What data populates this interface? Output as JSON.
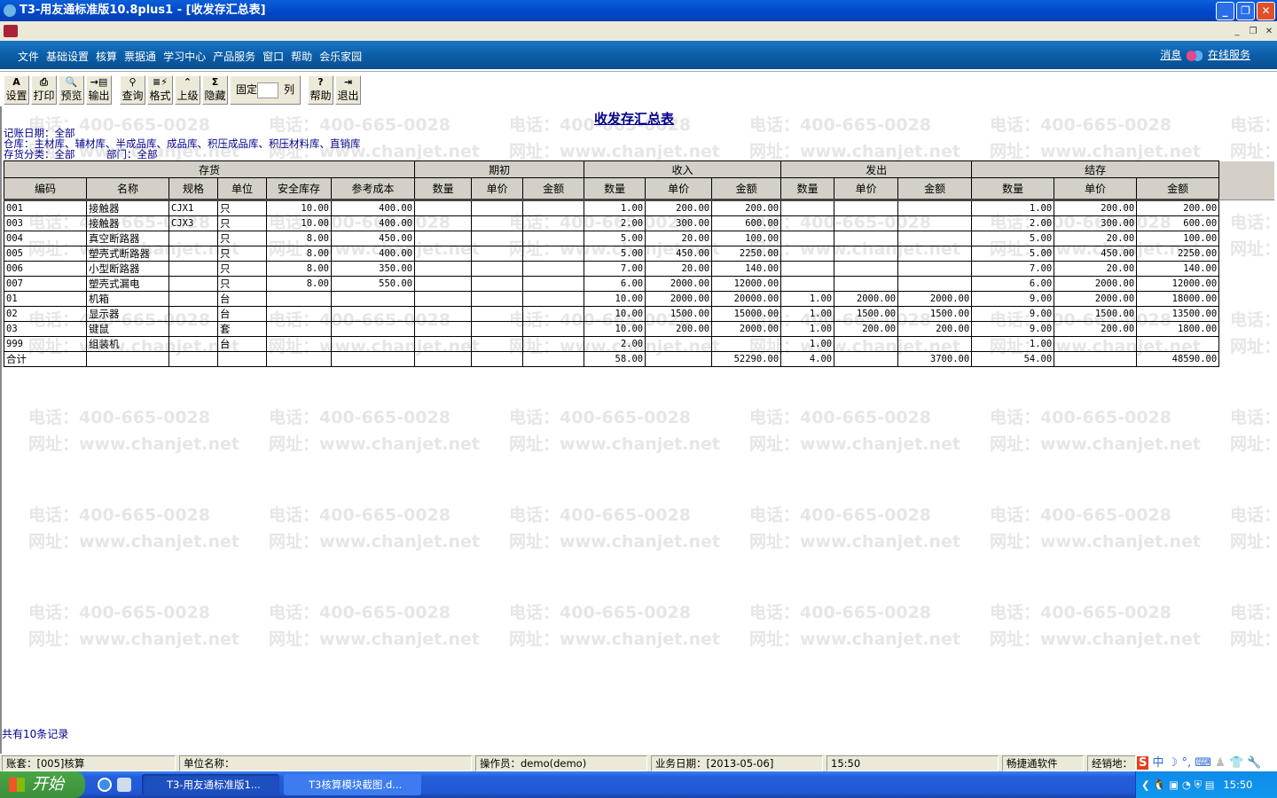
{
  "window": {
    "title": "T3-用友通标准版10.8plus1 - [收发存汇总表]"
  },
  "menu": {
    "items": [
      "文件",
      "基础设置",
      "核算",
      "票据通",
      "学习中心",
      "产品服务",
      "窗口",
      "帮助",
      "会乐家园"
    ],
    "message": "消息",
    "online_service": "在线服务"
  },
  "toolbar": {
    "buttons": [
      {
        "label": "设置",
        "icon": "A"
      },
      {
        "label": "打印",
        "icon": "⎙"
      },
      {
        "label": "预览",
        "icon": "🔍"
      },
      {
        "label": "输出",
        "icon": "→▤"
      },
      {
        "label": "查询",
        "icon": "⚲"
      },
      {
        "label": "格式",
        "icon": "≡⚡"
      },
      {
        "label": "上级",
        "icon": "⌃"
      },
      {
        "label": "隐藏",
        "icon": "Σ"
      },
      {
        "label": "帮助",
        "icon": "?"
      },
      {
        "label": "退出",
        "icon": "⇥"
      }
    ],
    "fix_label": "固定",
    "fix_value": "",
    "col_label": "列"
  },
  "report": {
    "title": "收发存汇总表",
    "conditions": {
      "date": "记账日期：全部",
      "warehouse": "仓库：主材库、辅材库、半成品库、成品库、积压成品库、积压材料库、直销库",
      "category": "存货分类：全部",
      "department": "部门：全部"
    },
    "group_headers": [
      "存货",
      "期初",
      "收入",
      "发出",
      "结存"
    ],
    "columns": [
      "编码",
      "名称",
      "规格",
      "单位",
      "安全库存",
      "参考成本",
      "数量",
      "单价",
      "金额",
      "数量",
      "单价",
      "金额",
      "数量",
      "单价",
      "金额",
      "数量",
      "单价",
      "金额"
    ],
    "rows": [
      [
        "001",
        "接触器",
        "CJX1",
        "只",
        "10.00",
        "400.00",
        "",
        "",
        "",
        "1.00",
        "200.00",
        "200.00",
        "",
        "",
        "",
        "1.00",
        "200.00",
        "200.00"
      ],
      [
        "003",
        "接触器",
        "CJX3",
        "只",
        "10.00",
        "400.00",
        "",
        "",
        "",
        "2.00",
        "300.00",
        "600.00",
        "",
        "",
        "",
        "2.00",
        "300.00",
        "600.00"
      ],
      [
        "004",
        "真空断路器",
        "",
        "只",
        "8.00",
        "450.00",
        "",
        "",
        "",
        "5.00",
        "20.00",
        "100.00",
        "",
        "",
        "",
        "5.00",
        "20.00",
        "100.00"
      ],
      [
        "005",
        "塑壳式断路器",
        "",
        "只",
        "8.00",
        "400.00",
        "",
        "",
        "",
        "5.00",
        "450.00",
        "2250.00",
        "",
        "",
        "",
        "5.00",
        "450.00",
        "2250.00"
      ],
      [
        "006",
        "小型断路器",
        "",
        "只",
        "8.00",
        "350.00",
        "",
        "",
        "",
        "7.00",
        "20.00",
        "140.00",
        "",
        "",
        "",
        "7.00",
        "20.00",
        "140.00"
      ],
      [
        "007",
        "塑壳式漏电",
        "",
        "只",
        "8.00",
        "550.00",
        "",
        "",
        "",
        "6.00",
        "2000.00",
        "12000.00",
        "",
        "",
        "",
        "6.00",
        "2000.00",
        "12000.00"
      ],
      [
        "01",
        "机箱",
        "",
        "台",
        "",
        "",
        "",
        "",
        "",
        "10.00",
        "2000.00",
        "20000.00",
        "1.00",
        "2000.00",
        "2000.00",
        "9.00",
        "2000.00",
        "18000.00"
      ],
      [
        "02",
        "显示器",
        "",
        "台",
        "",
        "",
        "",
        "",
        "",
        "10.00",
        "1500.00",
        "15000.00",
        "1.00",
        "1500.00",
        "1500.00",
        "9.00",
        "1500.00",
        "13500.00"
      ],
      [
        "03",
        "键鼠",
        "",
        "套",
        "",
        "",
        "",
        "",
        "",
        "10.00",
        "200.00",
        "2000.00",
        "1.00",
        "200.00",
        "200.00",
        "9.00",
        "200.00",
        "1800.00"
      ],
      [
        "999",
        "组装机",
        "",
        "台",
        "",
        "",
        "",
        "",
        "",
        "2.00",
        "",
        "",
        "1.00",
        "",
        "",
        "1.00",
        "",
        ""
      ],
      [
        "合计",
        "",
        "",
        "",
        "",
        "",
        "",
        "",
        "",
        "58.00",
        "",
        "52290.00",
        "4.00",
        "",
        "3700.00",
        "54.00",
        "",
        "48590.00"
      ]
    ],
    "record_count": "共有10条记录"
  },
  "watermark": {
    "phone": "电话：400-665-0028",
    "site": "网址：www.chanjet.net"
  },
  "status": {
    "account": "账套：[005]核算",
    "company": "单位名称：",
    "operator": "操作员：demo(demo)",
    "biz_date": "业务日期：[2013-05-06]",
    "time": "15:50",
    "vendor": "畅捷通软件",
    "dealer": "经销地："
  },
  "ime": {
    "brand": "S",
    "lang": "中"
  },
  "taskbar": {
    "start": "开始",
    "tasks": [
      "T3-用友通标准版1...",
      "T3核算模块截图.d..."
    ],
    "clock": "15:50"
  }
}
